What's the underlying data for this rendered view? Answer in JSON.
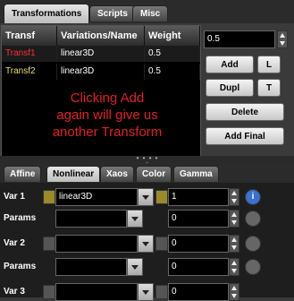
{
  "top_tabs": [
    "Transformations",
    "Scripts",
    "Misc"
  ],
  "table": {
    "headers": [
      "Transf",
      "Variations/Name",
      "Weight"
    ],
    "rows": [
      {
        "transf": "Transf1",
        "name": "linear3D",
        "weight": "0.5",
        "color": "#ff3030"
      },
      {
        "transf": "Transf2",
        "name": "linear3D",
        "weight": "0.5",
        "color": "#e8e070"
      }
    ]
  },
  "annotation_lines": [
    "Clicking Add",
    "again will give us",
    "another Transform"
  ],
  "weight_input": {
    "value": "0.5"
  },
  "buttons": {
    "add": "Add",
    "l": "L",
    "dupl": "Dupl",
    "t": "T",
    "delete": "Delete",
    "add_final": "Add Final"
  },
  "bottom_tabs": [
    "Affine",
    "Nonlinear",
    "Xaos",
    "Color",
    "Gamma"
  ],
  "variations": [
    {
      "label": "Var 1",
      "variation": "linear3D",
      "value": "1",
      "active": true
    },
    {
      "label": "Params",
      "variation": "",
      "value": "0",
      "active": false
    },
    {
      "label": "Var 2",
      "variation": "",
      "value": "0",
      "active": false
    },
    {
      "label": "Params",
      "variation": "",
      "value": "0",
      "active": false
    },
    {
      "label": "Var 3",
      "variation": "",
      "value": "0",
      "active": false
    }
  ],
  "colors": {
    "accent": "#c8c8c8",
    "annotation": "#e0202a",
    "info_blue": "#3b6fd1"
  }
}
